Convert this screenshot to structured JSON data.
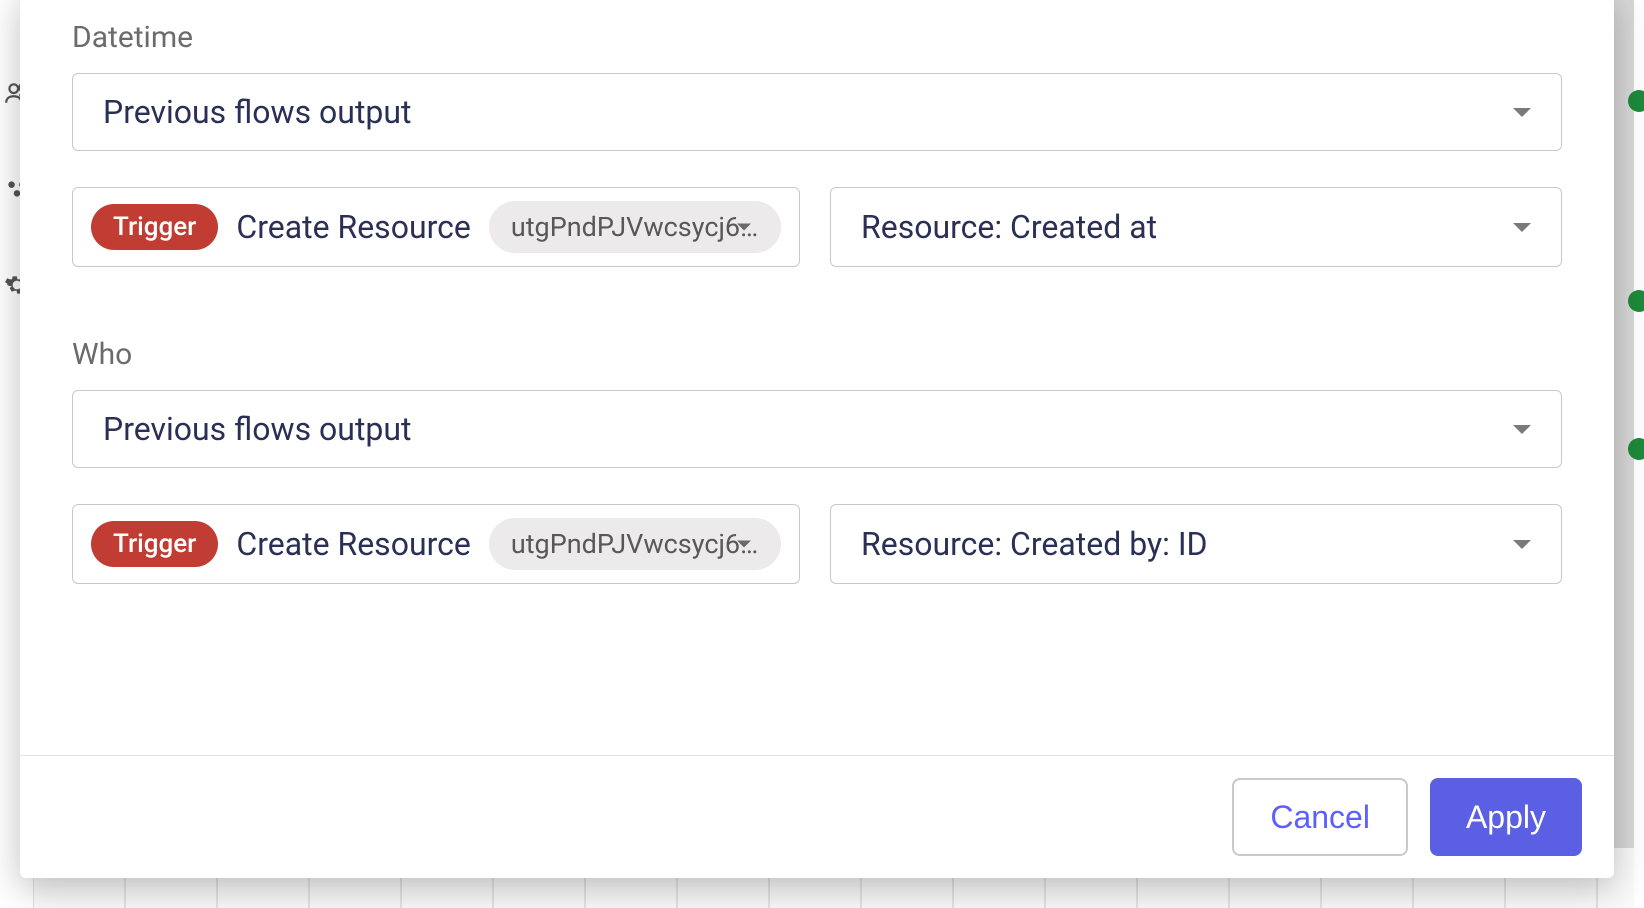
{
  "sections": {
    "datetime": {
      "label": "Datetime",
      "source_select": "Previous flows output",
      "trigger": {
        "badge": "Trigger",
        "title": "Create Resource",
        "id": "utgPndPJVwcsycj65CsY…"
      },
      "resource_select": "Resource: Created at"
    },
    "who": {
      "label": "Who",
      "source_select": "Previous flows output",
      "trigger": {
        "badge": "Trigger",
        "title": "Create Resource",
        "id": "utgPndPJVwcsycj65CsY…"
      },
      "resource_select": "Resource: Created by: ID"
    }
  },
  "footer": {
    "cancel": "Cancel",
    "apply": "Apply"
  }
}
